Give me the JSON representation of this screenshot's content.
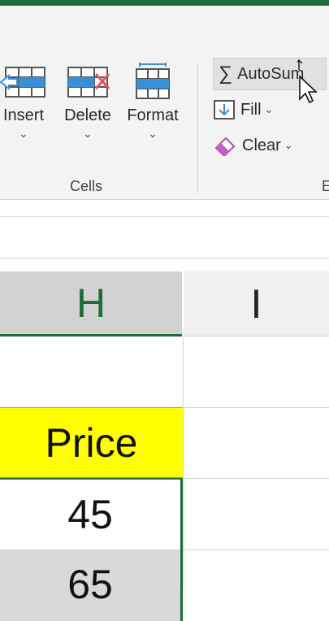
{
  "colors": {
    "accent": "#1e6b3c",
    "highlight": "#ffff00",
    "selected_bg": "#d9d9d9"
  },
  "ribbon": {
    "cells_group": {
      "label": "Cells",
      "insert": {
        "label": "Insert",
        "icon": "insert-cells-icon"
      },
      "delete": {
        "label": "Delete",
        "icon": "delete-cells-icon"
      },
      "format": {
        "label": "Format",
        "icon": "format-cells-icon"
      }
    },
    "editing_group": {
      "label_partial": "E",
      "autosum": {
        "label": "AutoSum",
        "icon": "sigma-icon"
      },
      "fill": {
        "label": "Fill",
        "icon": "fill-down-icon"
      },
      "clear": {
        "label": "Clear",
        "icon": "eraser-icon"
      }
    }
  },
  "grid": {
    "columns": [
      {
        "name": "H"
      },
      {
        "name": "I"
      }
    ],
    "cells": [
      {
        "value": ""
      },
      {
        "value": "Price"
      },
      {
        "value": "45"
      },
      {
        "value": "65"
      }
    ]
  }
}
